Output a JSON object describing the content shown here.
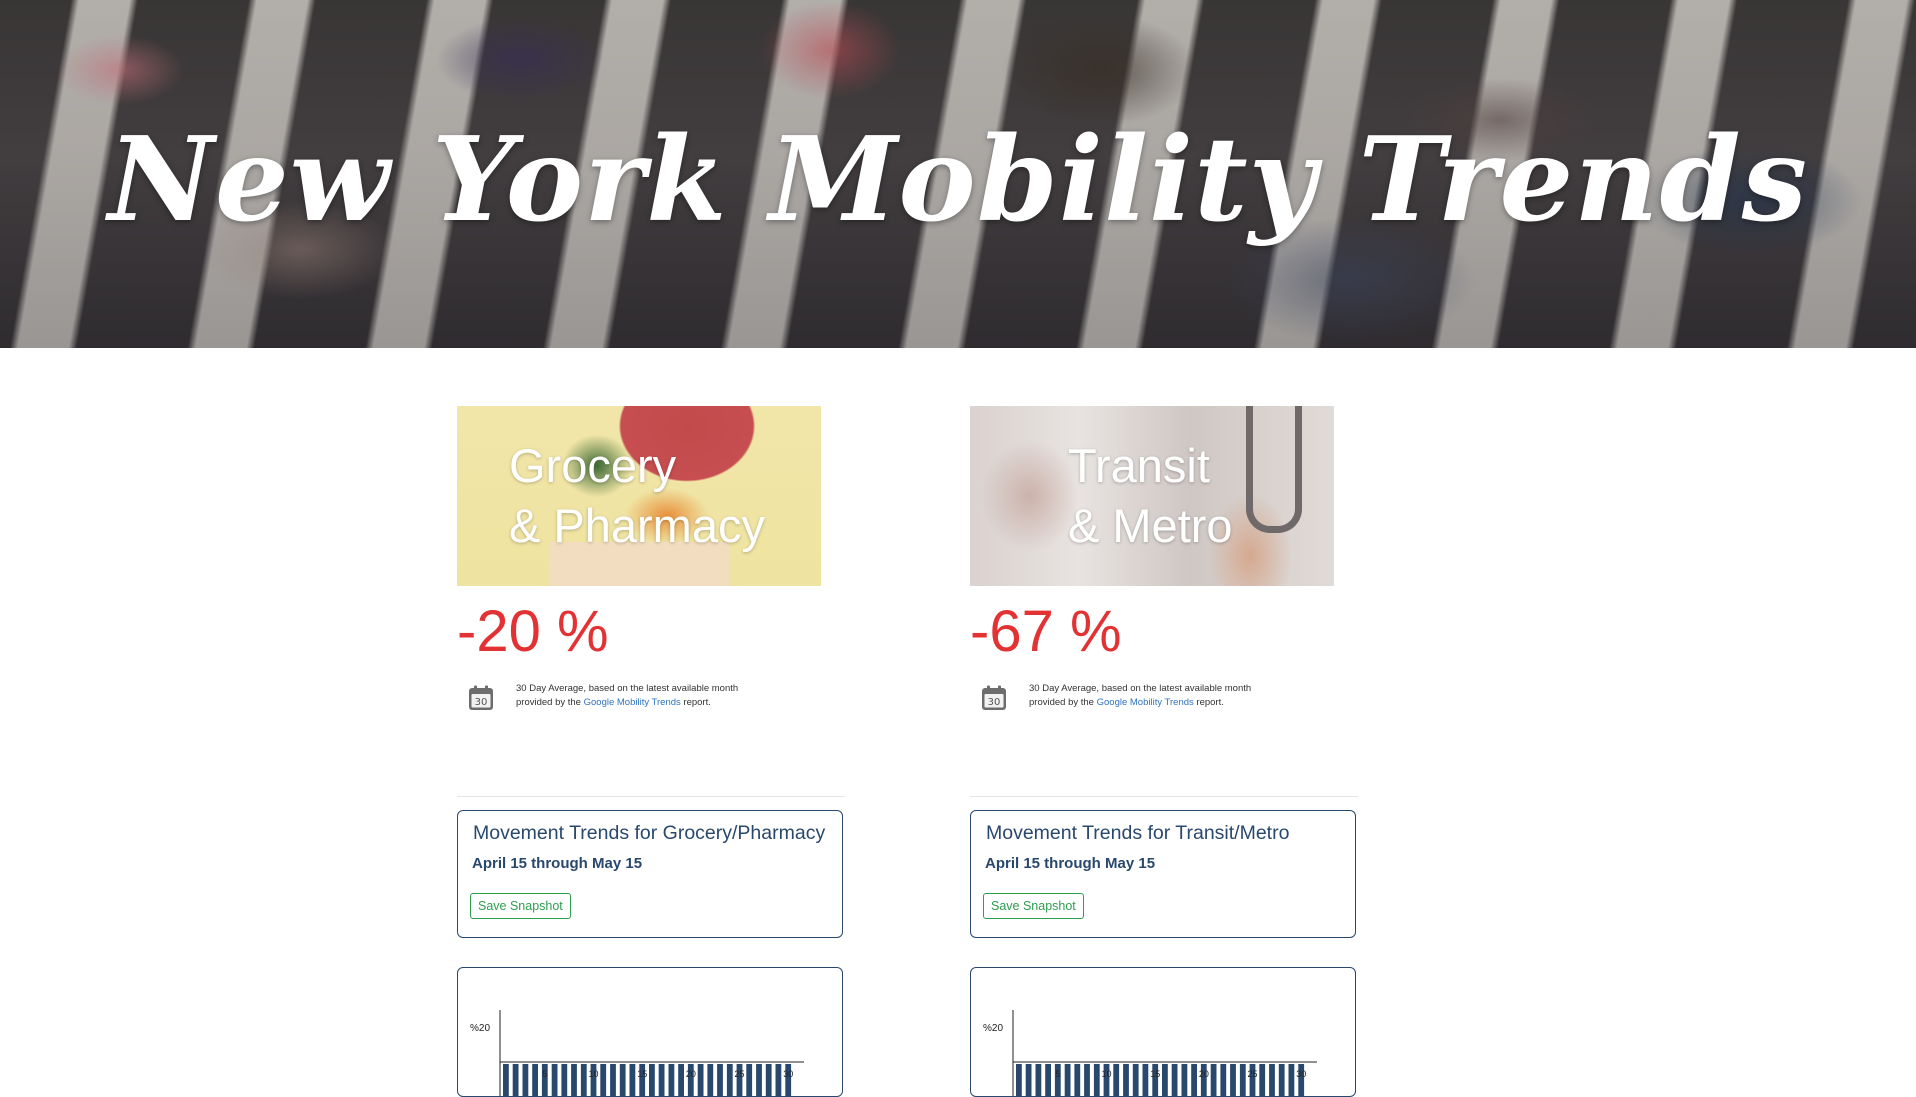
{
  "hero": {
    "title": "New York Mobility Trends"
  },
  "cards": [
    {
      "id": "grocery",
      "image_title_line1": "Grocery",
      "image_title_line2": "& Pharmacy",
      "metric": "-20 %",
      "note_before": "30 Day Average, based on the latest available month provided by the ",
      "note_link": "Google Mobility Trends",
      "note_after": " report.",
      "calendar_icon_text": "30",
      "trend_title": "Movement Trends for Grocery/Pharmacy",
      "trend_subtitle": "April 15 through May 15",
      "save_label": "Save Snapshot"
    },
    {
      "id": "transit",
      "image_title_line1": "Transit",
      "image_title_line2": "& Metro",
      "metric": "-67 %",
      "note_before": "30 Day Average, based on the latest available month provided by the ",
      "note_link": "Google Mobility Trends",
      "note_after": " report.",
      "calendar_icon_text": "30",
      "trend_title": "Movement Trends for Transit/Metro",
      "trend_subtitle": "April 15 through May 15",
      "save_label": "Save Snapshot"
    }
  ],
  "chart_data": [
    {
      "type": "bar",
      "y_tick_label": "%20",
      "x_tick_labels": [
        "5",
        "10",
        "15",
        "20",
        "25",
        "30"
      ],
      "bar_count": 30,
      "color": "#29486e"
    },
    {
      "type": "bar",
      "y_tick_label": "%20",
      "x_tick_labels": [
        "5",
        "10",
        "15",
        "20",
        "25",
        "30"
      ],
      "bar_count": 30,
      "color": "#29486e"
    }
  ],
  "colors": {
    "accent_red": "#e23234",
    "navy": "#29486e",
    "green": "#2e9e4f",
    "link_blue": "#2f74c0"
  }
}
